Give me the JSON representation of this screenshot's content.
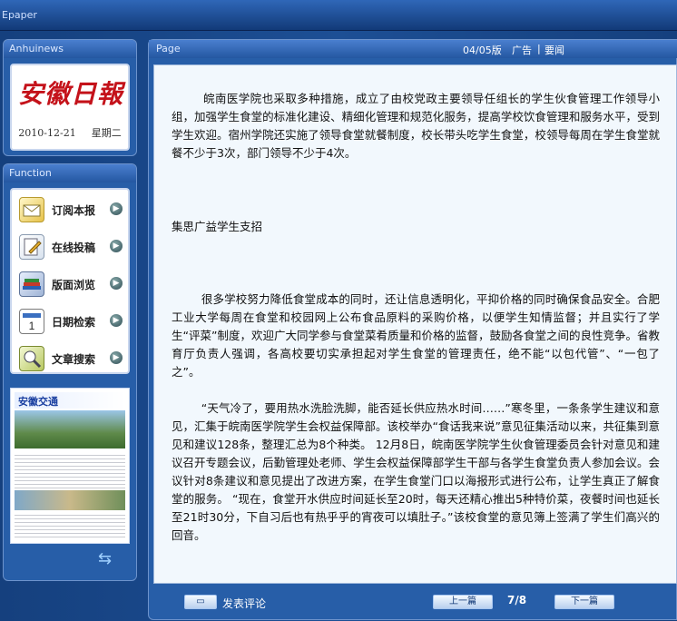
{
  "window": {
    "title": "Epaper"
  },
  "brand": {
    "panel_title": "Anhuinews",
    "logo_text": "安徽日報",
    "date": "2010-12-21",
    "weekday": "星期二"
  },
  "function_panel": {
    "title": "Function",
    "items": [
      {
        "label": "订阅本报",
        "icon": "envelope-icon"
      },
      {
        "label": "在线投稿",
        "icon": "pencil-icon"
      },
      {
        "label": "版面浏览",
        "icon": "books-icon"
      },
      {
        "label": "日期检索",
        "icon": "calendar-icon"
      },
      {
        "label": "文章搜索",
        "icon": "magnifier-icon"
      }
    ],
    "thumbnail_headline": "安徽交通"
  },
  "content": {
    "panel_title": "Page",
    "edition": "04/05版",
    "section_ad": "广告",
    "separator": "|",
    "section_news": "要闻",
    "paragraphs": [
      "        皖南医学院也采取多种措施，成立了由校党政主要领导任组长的学生伙食管理工作领导小组，加强学生食堂的标准化建设、精细化管理和规范化服务，提高学校饮食管理和服务水平，受到学生欢迎。宿州学院还实施了领导食堂就餐制度，校长带头吃学生食堂，校领导每周在学生食堂就餐不少于3次，部门领导不少于4次。",
      "集思广益学生支招",
      "        很多学校努力降低食堂成本的同时，还让信息透明化，平抑价格的同时确保食品安全。合肥工业大学每周在食堂和校园网上公布食品原料的采购价格，以便学生知情监督；并且实行了学生“评菜”制度，欢迎广大同学参与食堂菜肴质量和价格的监督，鼓励各食堂之间的良性竞争。省教育厅负责人强调，各高校要切实承担起对学生食堂的管理责任，绝不能“以包代管”、“一包了之”。",
      "        “天气冷了，要用热水洗脸洗脚，能否延长供应热水时间……”寒冬里，一条条学生建议和意见，汇集于皖南医学院学生会权益保障部。该校举办“食话我来说”意见征集活动以来，共征集到意见和建议128条，整理汇总为8个种类。 12月8日，皖南医学院学生伙食管理委员会针对意见和建议召开专题会议，后勤管理处老师、学生会权益保障部学生干部与各学生食堂负责人参加会议。会议针对8条建议和意见提出了改进方案，在学生食堂门口以海报形式进行公布，让学生真正了解食堂的服务。 “现在，食堂开水供应时间延长至20时，每天还精心推出5种特价菜，夜餐时间也延长至21时30分，下自习后也有热乎乎的宵夜可以填肚子。”该校食堂的意见簿上签满了学生们高兴的回音。"
    ]
  },
  "footer": {
    "comment_label": "发表评论",
    "prev_label": "上一篇",
    "page_indicator": "7/8",
    "next_label": "下一篇"
  }
}
